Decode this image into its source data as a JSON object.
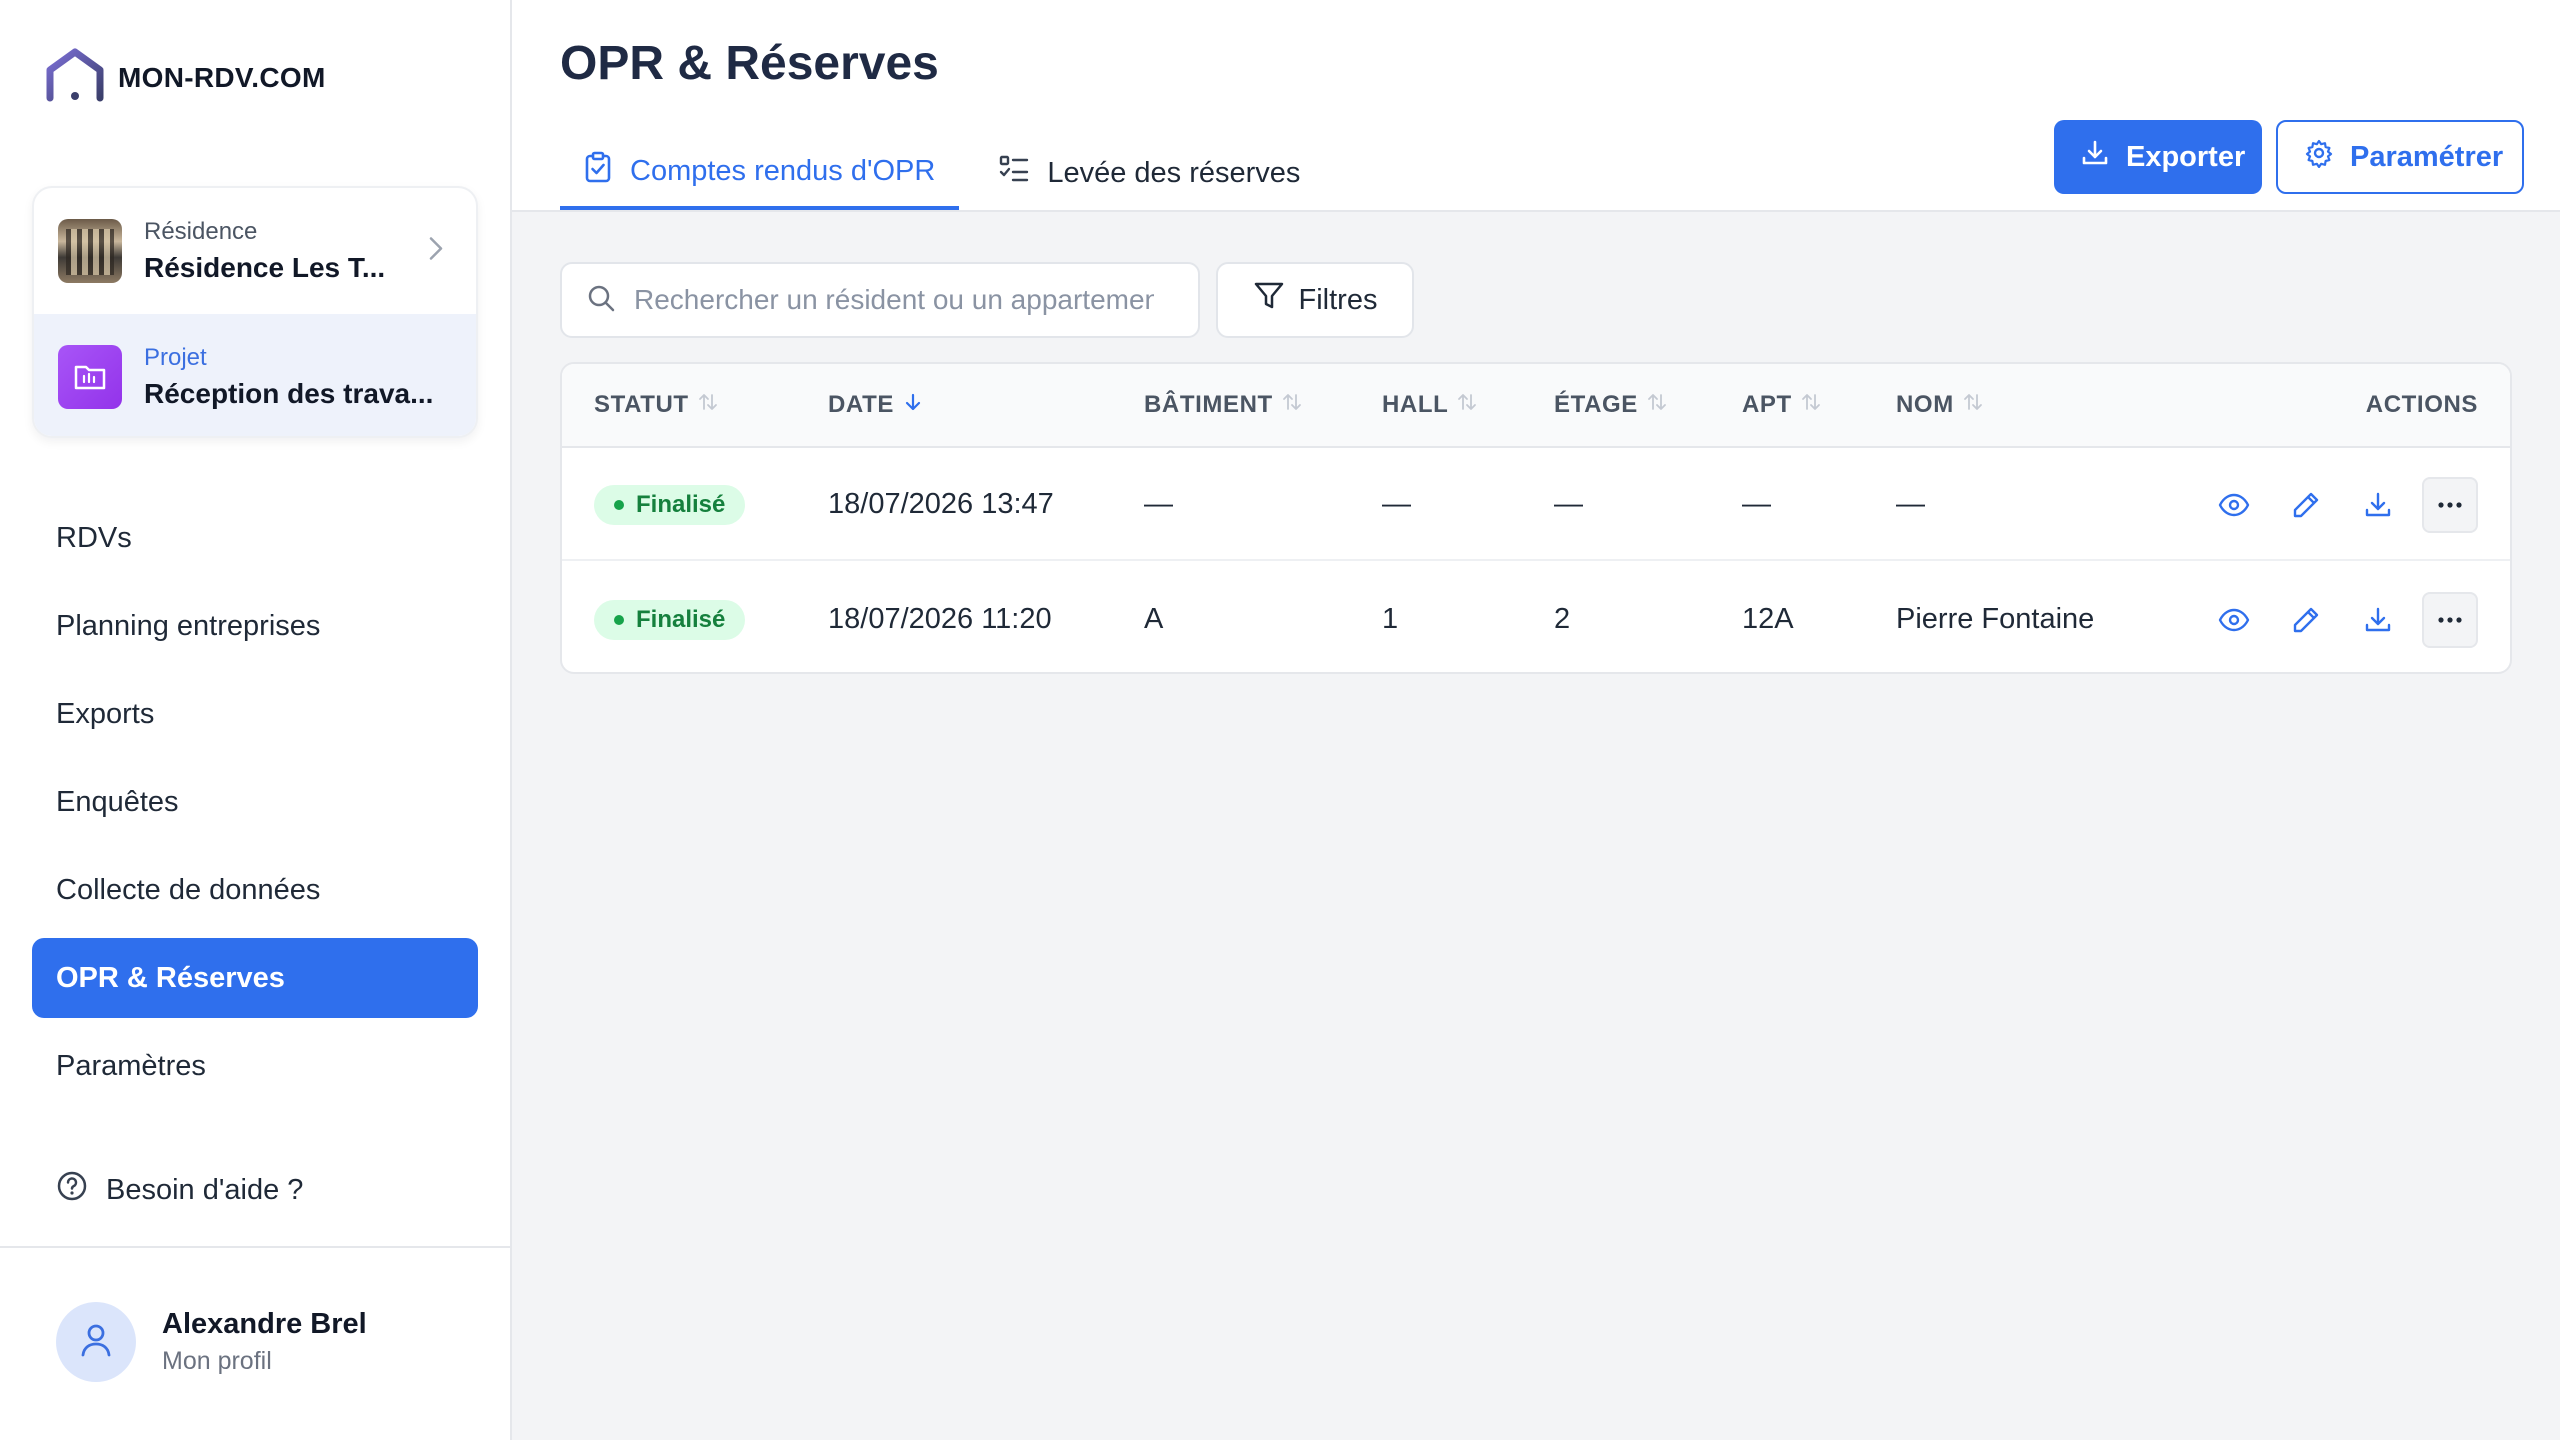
{
  "app": {
    "name": "MON-RDV.COM"
  },
  "context": {
    "residence_label": "Résidence",
    "residence_value": "Résidence Les T...",
    "project_label": "Projet",
    "project_value": "Réception des trava..."
  },
  "nav": {
    "items": [
      {
        "label": "RDVs"
      },
      {
        "label": "Planning entreprises"
      },
      {
        "label": "Exports"
      },
      {
        "label": "Enquêtes"
      },
      {
        "label": "Collecte de données"
      },
      {
        "label": "OPR & Réserves"
      },
      {
        "label": "Paramètres"
      }
    ],
    "active": "OPR & Réserves"
  },
  "help": {
    "label": "Besoin d'aide ?"
  },
  "profile": {
    "name": "Alexandre Brel",
    "subtitle": "Mon profil"
  },
  "header": {
    "title": "OPR & Réserves",
    "tabs": [
      {
        "label": "Comptes rendus d'OPR",
        "icon": "clipboard-check-icon",
        "active": true
      },
      {
        "label": "Levée des réserves",
        "icon": "checklist-icon",
        "active": false
      }
    ],
    "export_label": "Exporter",
    "settings_label": "Paramétrer"
  },
  "search": {
    "placeholder": "Rechercher un résident ou un appartement",
    "value": ""
  },
  "filters": {
    "label": "Filtres"
  },
  "table": {
    "columns": [
      {
        "label": "STATUT",
        "sort": "none"
      },
      {
        "label": "DATE",
        "sort": "desc"
      },
      {
        "label": "BÂTIMENT",
        "sort": "none"
      },
      {
        "label": "HALL",
        "sort": "none"
      },
      {
        "label": "ÉTAGE",
        "sort": "none"
      },
      {
        "label": "APT",
        "sort": "none"
      },
      {
        "label": "NOM",
        "sort": "none"
      },
      {
        "label": "ACTIONS",
        "sort": "none"
      }
    ],
    "rows": [
      {
        "status": "Finalisé",
        "date": "18/07/2026 13:47",
        "batiment": "—",
        "hall": "—",
        "etage": "—",
        "apt": "—",
        "nom": "—"
      },
      {
        "status": "Finalisé",
        "date": "18/07/2026 11:20",
        "batiment": "A",
        "hall": "1",
        "etage": "2",
        "apt": "12A",
        "nom": "Pierre Fontaine"
      }
    ]
  },
  "colors": {
    "accent": "#2f6fed",
    "status_success_bg": "#dcfce7",
    "status_success_text": "#15803d",
    "project_icon": "#9333ea"
  }
}
